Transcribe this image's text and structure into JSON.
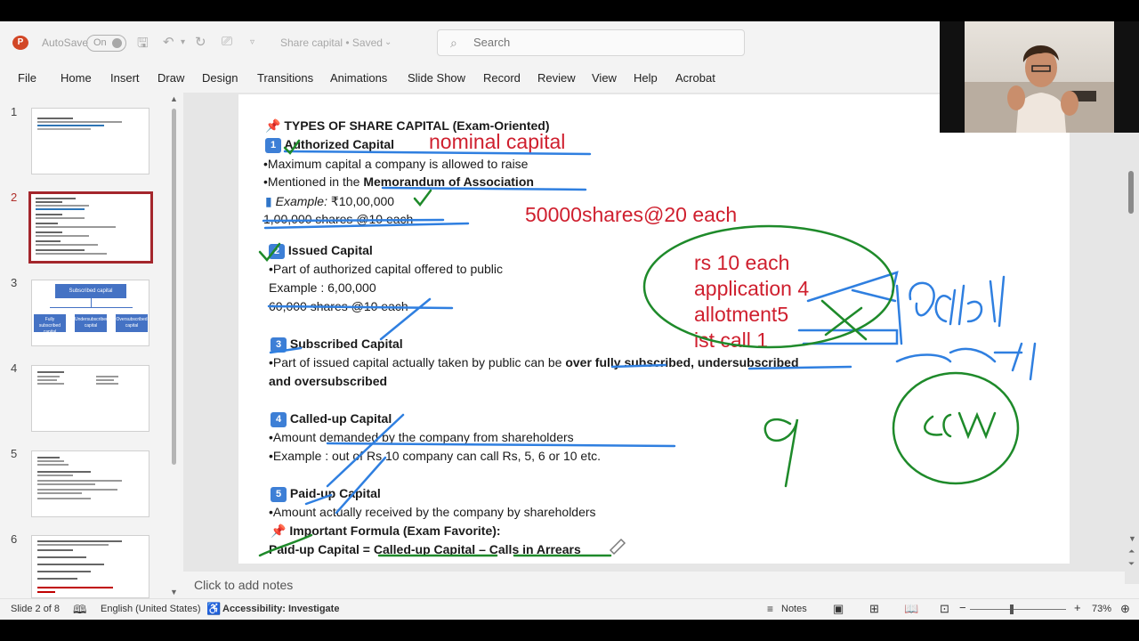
{
  "titlebar": {
    "autosave_label": "AutoSave",
    "autosave_state": "On",
    "doc_title": "Share capital • Saved",
    "search_placeholder": "Search"
  },
  "menu": [
    "File",
    "Home",
    "Insert",
    "Draw",
    "Design",
    "Transitions",
    "Animations",
    "Slide Show",
    "Record",
    "Review",
    "View",
    "Help",
    "Acrobat"
  ],
  "thumbnails": {
    "numbers": [
      "1",
      "2",
      "3",
      "4",
      "5",
      "6"
    ],
    "active": "2",
    "slide3_title": "Subscribed capital",
    "slide3_boxes": [
      "Fully subscribed capital",
      "Undersubscribed capital",
      "Oversubscribed capital"
    ]
  },
  "slide": {
    "heading": "TYPES OF SHARE CAPITAL (Exam-Oriented)",
    "s1_num": "1",
    "s1_title": "Authorized Capital",
    "s1_l1": "•Maximum capital a company is allowed to raise",
    "s1_l2a": "•Mentioned in the ",
    "s1_l2b": "Memorandum of Association",
    "s1_ex_label": "Example:",
    "s1_ex_value": " ₹10,00,000",
    "s1_l4": "1,00,000 shares @10 each",
    "s2_num": "2",
    "s2_title": "Issued Capital",
    "s2_l1": "•Part of authorized capital offered to public",
    "s2_l2": "Example : 6,00,000",
    "s2_l3": "60,000 shares @10 each",
    "s3_num": "3",
    "s3_title": "Subscribed Capital",
    "s3_l1a": "•Part of issued capital actually taken by public can be ",
    "s3_l1b": "over fully subscribed, undersubscribed",
    "s3_l2": "and oversubscribed",
    "s4_num": "4",
    "s4_title": "Called-up Capital",
    "s4_l1": "•Amount demanded by the company from shareholders",
    "s4_l2": "•Example : out of Rs.10 company can call Rs, 5, 6 or 10 etc.",
    "s5_num": "5",
    "s5_title": "Paid-up Capital",
    "s5_l1": "•Amount actually received by the company by shareholders",
    "formula_title": "Important Formula (Exam Favorite):",
    "formula": "Paid-up Capital = Called-up Capital – Calls in Arrears"
  },
  "annotations": {
    "nominal": "nominal capital",
    "shares": "50000shares@20 each",
    "rs10": "rs 10 each",
    "application": "application 4",
    "allotment": "allotment5",
    "call1": "ist call 1"
  },
  "notes_placeholder": "Click to add notes",
  "status": {
    "slide_info": "Slide 2 of 8",
    "language": "English (United States)",
    "accessibility": "Accessibility: Investigate",
    "notes_btn": "Notes",
    "zoom": "73%"
  },
  "colors": {
    "accent": "#b7472a",
    "ink_blue": "#2f7fe0",
    "ink_green": "#1e8a2a",
    "ink_red": "#cf1f2e"
  }
}
